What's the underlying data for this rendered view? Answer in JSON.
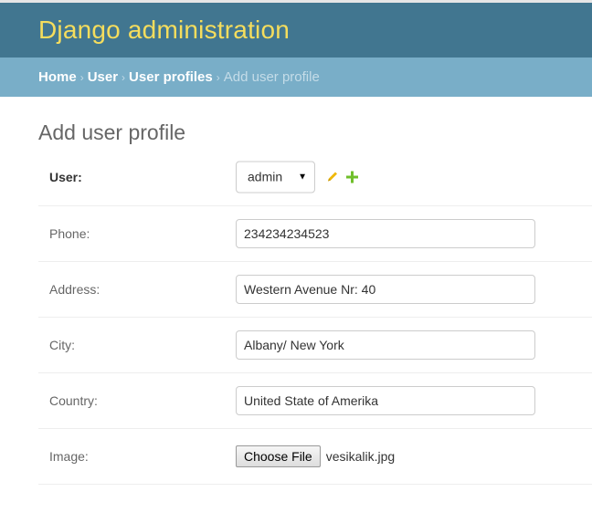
{
  "header": {
    "site_title": "Django administration"
  },
  "breadcrumbs": {
    "items": [
      "Home",
      "User",
      "User profiles"
    ],
    "separator": "›",
    "current": "Add user profile"
  },
  "page": {
    "title": "Add user profile"
  },
  "form": {
    "user": {
      "label": "User:",
      "selected": "admin",
      "change_icon": "pencil-icon",
      "add_icon": "plus-icon"
    },
    "phone": {
      "label": "Phone:",
      "value": "234234234523"
    },
    "address": {
      "label": "Address:",
      "value": "Western Avenue Nr: 40"
    },
    "city": {
      "label": "City:",
      "value": "Albany/ New York"
    },
    "country": {
      "label": "Country:",
      "value": "United State of Amerika"
    },
    "image": {
      "label": "Image:",
      "button_label": "Choose File",
      "file_name": "vesikalik.jpg"
    }
  },
  "colors": {
    "header_bg": "#417690",
    "title_yellow": "#f5dd5d",
    "breadcrumb_bg": "#79aec8",
    "add_green": "#70bf2b",
    "change_yellow": "#efb80b"
  }
}
